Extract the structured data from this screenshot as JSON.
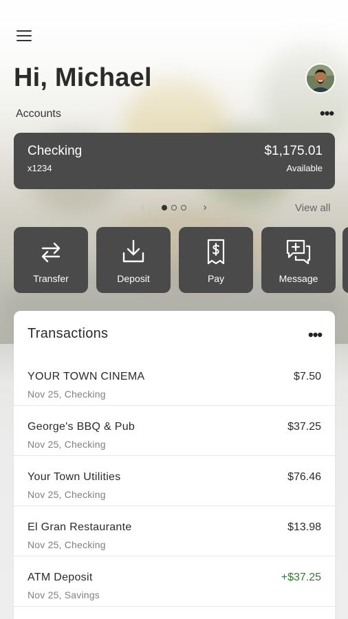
{
  "header": {
    "greeting": "Hi, Michael",
    "menu_icon": "hamburger-menu-icon",
    "avatar": "user-avatar"
  },
  "accounts": {
    "label": "Accounts",
    "more_icon": "more-options-icon",
    "card": {
      "name": "Checking",
      "number": "x1234",
      "balance": "$1,175.01",
      "balance_label": "Available"
    },
    "pager": {
      "page_count": 3,
      "active_page": 1
    },
    "view_all": "View all"
  },
  "actions": [
    {
      "label": "Transfer",
      "icon": "transfer-icon"
    },
    {
      "label": "Deposit",
      "icon": "deposit-icon"
    },
    {
      "label": "Pay",
      "icon": "pay-icon"
    },
    {
      "label": "Message",
      "icon": "message-icon"
    }
  ],
  "transactions": {
    "title": "Transactions",
    "items": [
      {
        "merchant": "YOUR TOWN CINEMA",
        "meta": "Nov 25, Checking",
        "amount": "$7.50",
        "credit": false
      },
      {
        "merchant": "George's BBQ & Pub",
        "meta": "Nov 25, Checking",
        "amount": "$37.25",
        "credit": false
      },
      {
        "merchant": "Your Town Utilities",
        "meta": "Nov 25, Checking",
        "amount": "$76.46",
        "credit": false
      },
      {
        "merchant": "El Gran Restaurante",
        "meta": "Nov 25, Checking",
        "amount": "$13.98",
        "credit": false
      },
      {
        "merchant": "ATM Deposit",
        "meta": "Nov 25, Savings",
        "amount": "+$37.25",
        "credit": true
      }
    ]
  },
  "colors": {
    "card": "#4a4a4a",
    "credit": "#2e7d32",
    "text": "#2a2a2a",
    "muted": "#808080"
  }
}
